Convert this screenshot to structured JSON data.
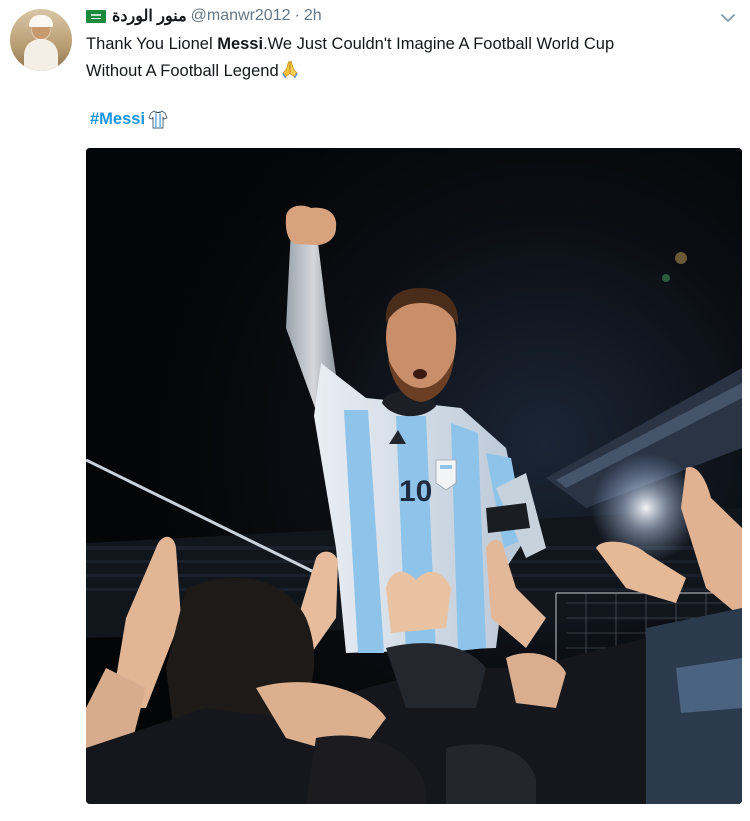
{
  "tweet": {
    "display_name": "منور الوردة",
    "handle": "@manwr2012",
    "separator": "·",
    "time": "2h",
    "text_line1_before": "Thank You Lionel ",
    "text_line1_bold": "Messi",
    "text_line1_after": ".We Just Couldn't Imagine A Football  World Cup",
    "text_line2": "Without A Football Legend",
    "hashtag": "#Messi"
  },
  "photo": {
    "jersey_number": "10"
  },
  "icons": {
    "flag": "saudi-flag-icon",
    "menu": "chevron-down-icon",
    "pray": "folded-hands-emoji",
    "jersey": "argentina-jersey-emoji"
  },
  "colors": {
    "link": "#1b95e0",
    "meta": "#657786",
    "text": "#14171a",
    "jersey_blue": "#8ec3ea"
  }
}
